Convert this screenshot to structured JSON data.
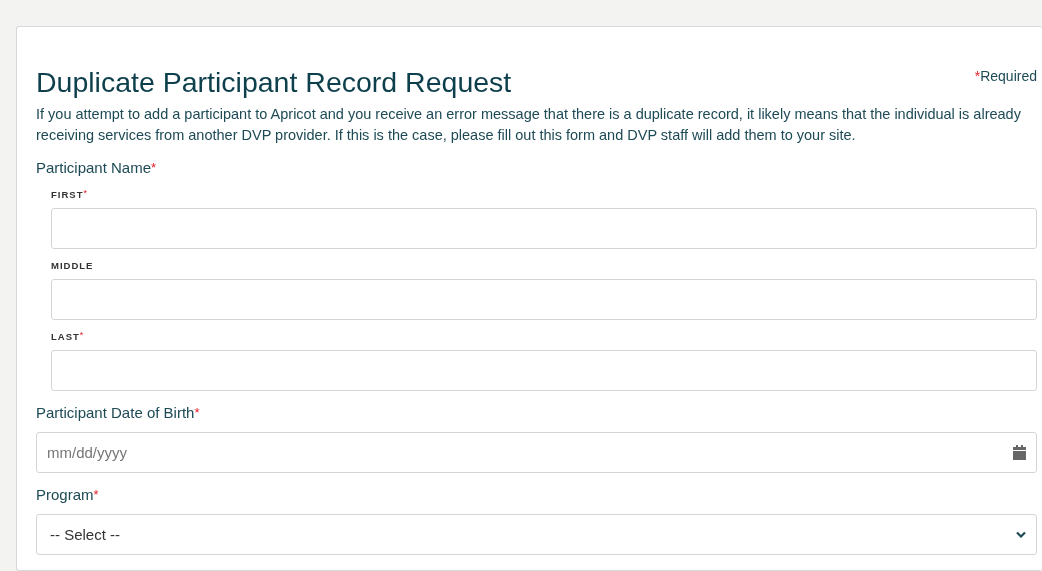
{
  "form": {
    "title": "Duplicate Participant Record Request",
    "required_note": {
      "mark": "*",
      "text": "Required"
    },
    "intro": "If you attempt to add a participant to Apricot and you receive an error message that there is a duplicate record, it likely means that the individual is already receiving services from another DVP provider. If this is the case, please fill out this form and DVP staff will add them to your site.",
    "fields": [
      {
        "kind": "name",
        "label": "Participant Name",
        "marker": "*",
        "parts": [
          {
            "label": "FIRST",
            "marker": "*"
          },
          {
            "label": "MIDDLE"
          },
          {
            "label": "LAST",
            "marker": "*"
          }
        ]
      },
      {
        "kind": "date",
        "label": "Participant Date of Birth",
        "marker": "*",
        "placeholder": "mm/dd/yyyy"
      },
      {
        "kind": "select",
        "label": "Program",
        "marker": "*",
        "value": "-- Select --"
      }
    ]
  }
}
